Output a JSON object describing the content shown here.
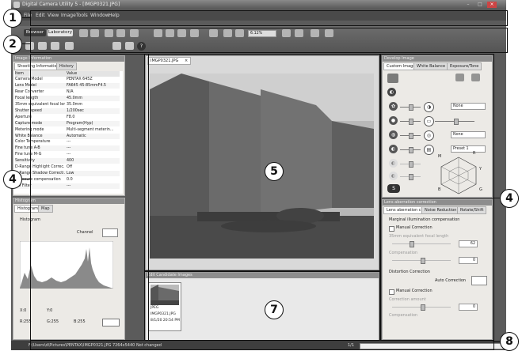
{
  "app": {
    "title": "Digital Camera Utility 5 - [IMGP0321.JPG]",
    "window_controls": [
      "–",
      "□",
      "×"
    ]
  },
  "menu": [
    "File",
    "Edit",
    "View",
    "Image",
    "Tools",
    "Window",
    "Help"
  ],
  "toolbar": {
    "tab_browser": "Browser",
    "tab_laboratory": "Laboratory",
    "zoom_value": "6.12%"
  },
  "left_panel": {
    "title": "Image Information",
    "tabs": [
      "Shooting Information",
      "History"
    ],
    "columns": [
      "Item",
      "Value"
    ],
    "rows": [
      [
        "Camera Model",
        "PENTAX 645Z"
      ],
      [
        "Lens Model",
        "FA645 45-85mmF4.5"
      ],
      [
        "Rear Converter",
        "N/A"
      ],
      [
        "Focal length",
        "45.0mm"
      ],
      [
        "35mm equivalent focal len...",
        "35.0mm"
      ],
      [
        "Shutter speed",
        "1/200sec"
      ],
      [
        "Aperture",
        "F8.0"
      ],
      [
        "Capture mode",
        "Program(Hyp)"
      ],
      [
        "Metering mode",
        "Multi-segment meterin..."
      ],
      [
        "White Balance",
        "Automatic"
      ],
      [
        "Color Temperature",
        "---"
      ],
      [
        "Fine tune A-B",
        "---"
      ],
      [
        "Fine tune M-G",
        "---"
      ],
      [
        "Sensitivity",
        "400"
      ],
      [
        "D-Range Highlight Correc...",
        "Off"
      ],
      [
        "D-Range Shadow Correcti...",
        "Low"
      ],
      [
        "Exposure compensation",
        "0.0"
      ],
      [
        "ND Filter",
        "---"
      ]
    ]
  },
  "histogram_panel": {
    "title": "Histogram",
    "tabs": [
      "Histogram",
      "Map"
    ],
    "label": "Histogram",
    "channel_label": "Channel",
    "xy": [
      "X:0",
      "Y:0"
    ],
    "rgb": [
      "R:255",
      "G:255",
      "B:255"
    ]
  },
  "image_tab": {
    "filename": "IMGP0321.JPG",
    "close": "×"
  },
  "candidates": {
    "title": "Edit Candidate Images",
    "thumb_lines": [
      "JPEG",
      "IMGP0321.JPG",
      "8/1/20   20:54 PM"
    ]
  },
  "right_panel": {
    "title": "Develop Image",
    "tabs": [
      "Custom Image",
      "White Balance",
      "Exposure/Tone"
    ],
    "dropdowns": [
      "None",
      "None",
      "Preset 1"
    ],
    "radar_labels": [
      "M",
      "R",
      "Y",
      "B",
      "G"
    ]
  },
  "lens_panel": {
    "title": "Lens aberration correction",
    "tabs": [
      "Lens aberration c...",
      "Noise Reduction",
      "Rotate/Shift"
    ],
    "marginal_title": "Marginal illumination compensation",
    "manual1": "Manual Correction",
    "focal_label": "35mm equivalent focal length",
    "focal_value": "62",
    "compensation_label": "Compensation",
    "comp_value": "0",
    "distortion_title": "Distortion Correction",
    "auto_correction": "Auto Correction",
    "manual2": "Manual Correction",
    "correction_label": "Correction amount",
    "corr_value": "0",
    "compensation2": "Compensation"
  },
  "statusbar": {
    "path": "F:\\Users\\d\\Pictures\\PENTAX\\IMGP0321.JPG  7264x5440  Not changed",
    "page": "1/1"
  },
  "callouts": [
    "1",
    "2",
    "4",
    "4",
    "5",
    "7",
    "8"
  ]
}
